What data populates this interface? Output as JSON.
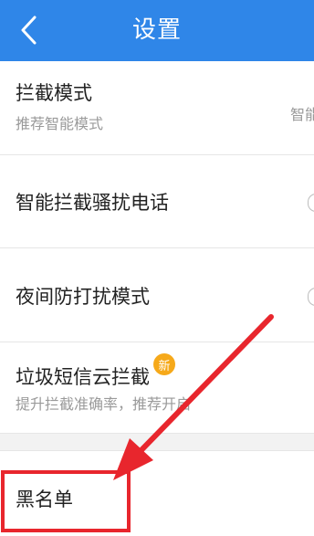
{
  "header": {
    "title": "设置",
    "back_icon": "chevron-left-icon",
    "background_color": "#2f86e8"
  },
  "settings": {
    "items": [
      {
        "label": "拦截模式",
        "subtitle": "推荐智能模式",
        "value": "智能"
      },
      {
        "label": "智能拦截骚扰电话"
      },
      {
        "label": "夜间防打扰模式"
      },
      {
        "label": "垃圾短信云拦截",
        "badge": "新",
        "subtitle": "提升拦截准确率，推荐开启"
      }
    ],
    "blacklist": {
      "label": "黑名单"
    }
  },
  "annotation": {
    "color": "#e8262d",
    "arrow_icon": "red-arrow-icon"
  }
}
